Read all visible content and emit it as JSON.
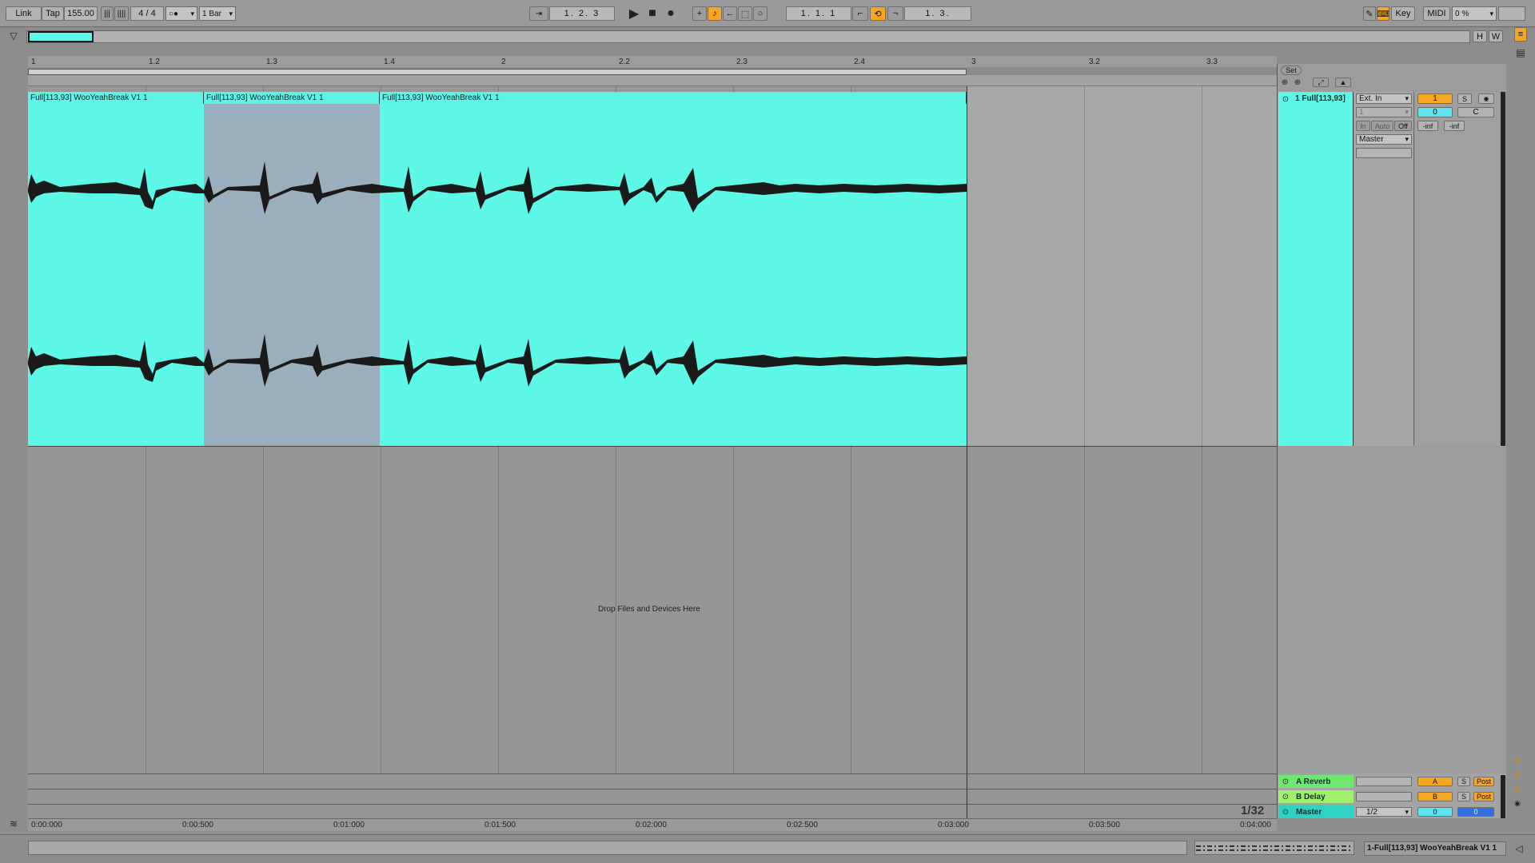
{
  "toolbar": {
    "link": "Link",
    "tap": "Tap",
    "tempo": "155.00",
    "time_signature": "4 / 4",
    "metronome": "○●",
    "quantize": "1 Bar",
    "follow_icon": "follow-icon",
    "position": "1.  2.  3",
    "loop_start": "1.  1.  1",
    "loop_length": "1.  3.",
    "key": "Key",
    "midi": "MIDI",
    "cpu": "0 %",
    "h_btn": "H",
    "w_btn": "W"
  },
  "ruler": {
    "bars": [
      "1",
      "1.2",
      "1.3",
      "1.4",
      "2",
      "2.2",
      "2.3",
      "2.4",
      "3",
      "3.2",
      "3.3"
    ]
  },
  "clips": [
    {
      "name": "Full[113,93] WooYeahBreak V1 1"
    },
    {
      "name": "Full[113,93] WooYeahBreak V1 1"
    },
    {
      "name": "Full[113,93] WooYeahBreak V1 1"
    }
  ],
  "arrangement": {
    "drop_hint": "Drop Files and Devices Here",
    "zoom_grid": "1/32"
  },
  "time_ruler": [
    "0:00:000",
    "0:00:500",
    "0:01:000",
    "0:01:500",
    "0:02:000",
    "0:02:500",
    "0:03:000",
    "0:03:500",
    "0:04:000"
  ],
  "mixer": {
    "set_label": "Set",
    "track": {
      "name": "1 Full[113,93]",
      "input_type": "Ext. In",
      "input_channel": "1",
      "monitor_in": "In",
      "monitor_auto": "Auto",
      "monitor_off": "Off",
      "output": "Master",
      "number": "1",
      "solo": "S",
      "volume": "0",
      "pan": "C",
      "peak_left": "-inf",
      "peak_right": "-inf"
    },
    "returns": [
      {
        "name": "A Reverb",
        "letter": "A",
        "solo": "S",
        "post": "Post",
        "color": "#6ee86e"
      },
      {
        "name": "B Delay",
        "letter": "B",
        "solo": "S",
        "post": "Post",
        "color": "#9ff06a"
      }
    ],
    "master": {
      "name": "Master",
      "cue": "1/2",
      "volume": "0",
      "pan": "0",
      "color": "#2ed3c4"
    }
  },
  "status": {
    "clip_name": "1-Full[113,93] WooYeahBreak V1 1"
  },
  "colors": {
    "clip": "#5ef8e7",
    "accent": "#f5a623",
    "selection": "#9aafbd"
  }
}
